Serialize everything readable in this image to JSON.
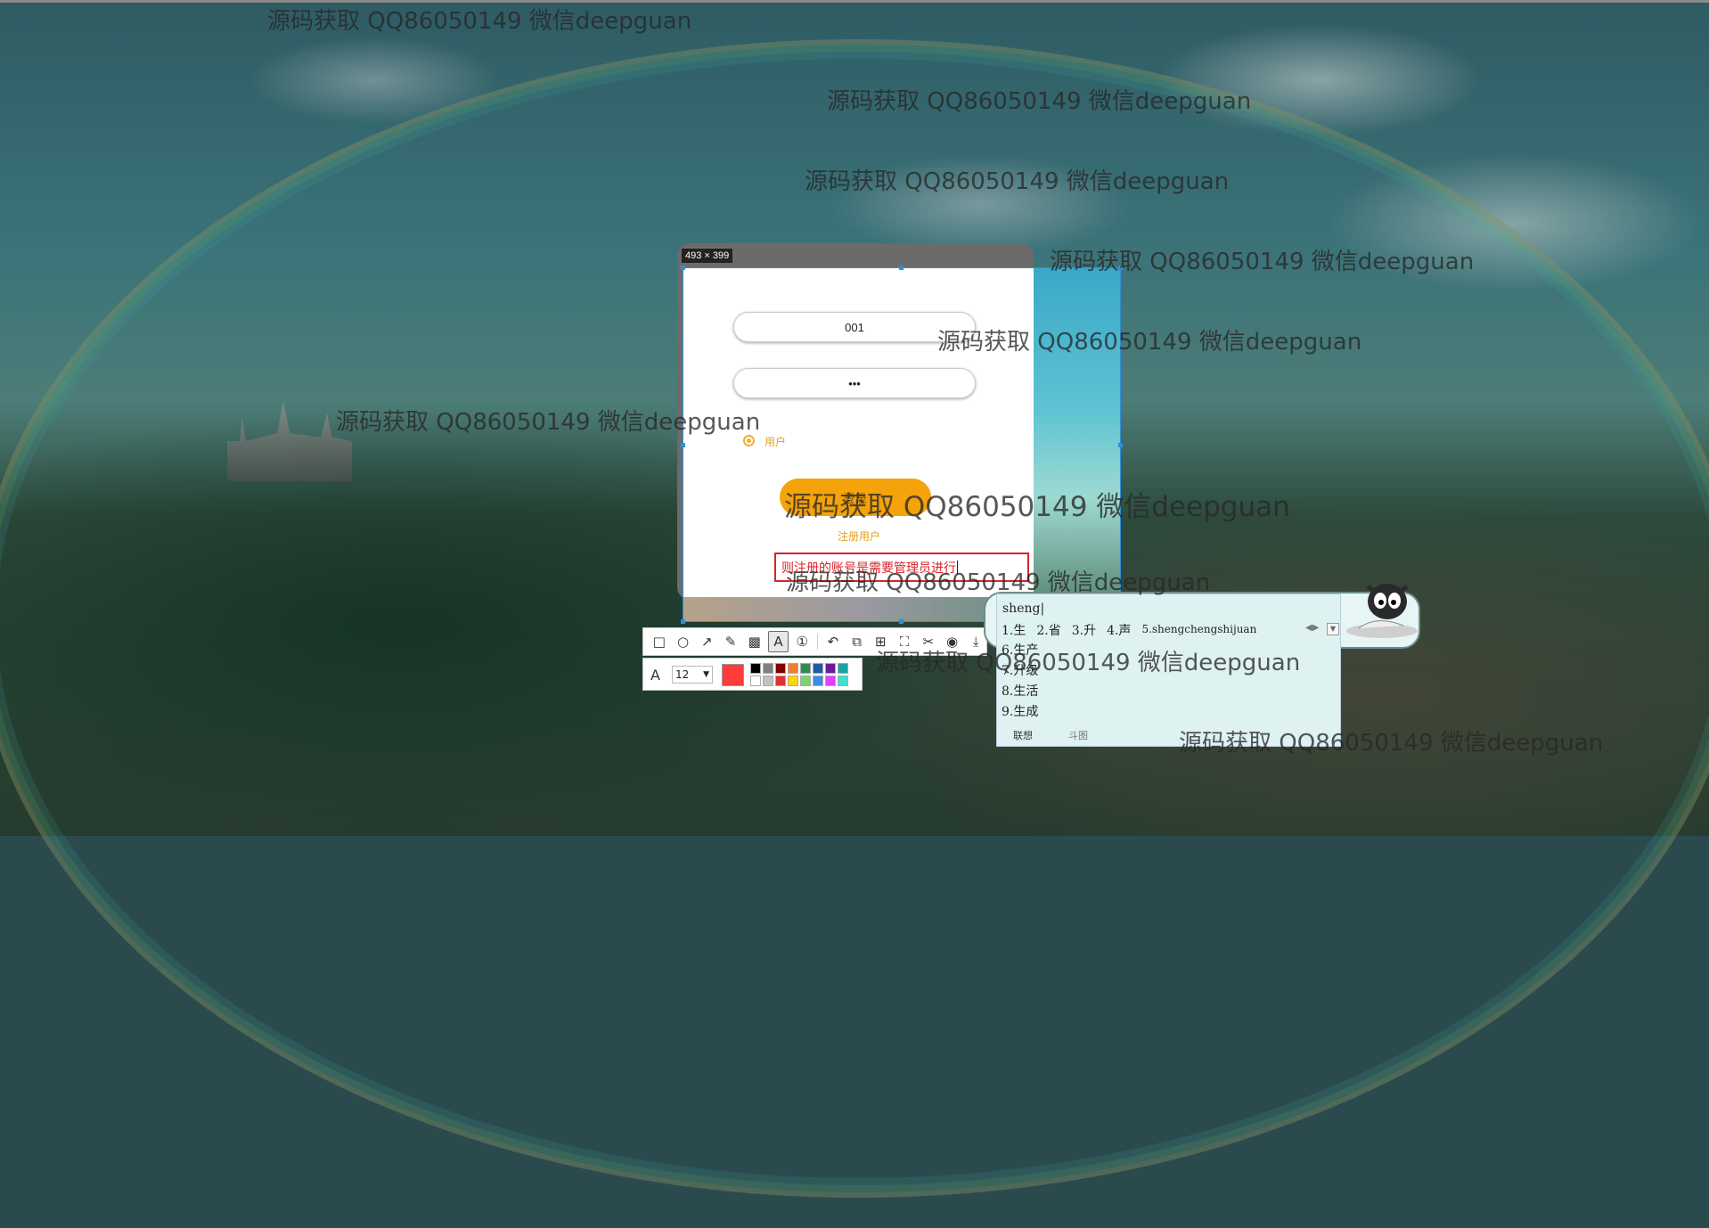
{
  "watermark_text": "源码获取 QQ86050149 微信deepguan",
  "capture": {
    "size_label": "493 × 399"
  },
  "login_form": {
    "username_value": "001",
    "password_value": "•••",
    "role_radio_label": "用户",
    "login_button_label": "登录",
    "register_link": "注册用户"
  },
  "annotation": {
    "text": "则注册的账号是需要管理员进行"
  },
  "toolbar": {
    "tools": [
      {
        "name": "rectangle-tool-icon",
        "glyph": "□"
      },
      {
        "name": "ellipse-tool-icon",
        "glyph": "○"
      },
      {
        "name": "arrow-tool-icon",
        "glyph": "↗"
      },
      {
        "name": "pen-tool-icon",
        "glyph": "✎"
      },
      {
        "name": "mosaic-tool-icon",
        "glyph": "▩"
      },
      {
        "name": "text-tool-icon",
        "glyph": "A"
      },
      {
        "name": "number-tool-icon",
        "glyph": "①"
      },
      {
        "name": "undo-icon",
        "glyph": "↶"
      },
      {
        "name": "translate-icon",
        "glyph": "⧉"
      },
      {
        "name": "ocr-icon",
        "glyph": "⊞"
      },
      {
        "name": "long-screenshot-icon",
        "glyph": "⛶"
      },
      {
        "name": "pin-icon",
        "glyph": "✂"
      },
      {
        "name": "record-icon",
        "glyph": "◉"
      },
      {
        "name": "save-icon",
        "glyph": "⤓"
      }
    ],
    "font_size": "12",
    "current_color": "#ff3b3b",
    "palette": [
      "#000000",
      "#808080",
      "#800000",
      "#f08030",
      "#2e8b57",
      "#1e5aa8",
      "#6a1b9a",
      "#1aa3a3",
      "#ffffff",
      "#c0c0c0",
      "#e03030",
      "#ffd700",
      "#7cd070",
      "#3a8ee6",
      "#e040fb",
      "#40e0d0"
    ]
  },
  "ime": {
    "pinyin": "sheng",
    "candidates": [
      {
        "text": "1.生"
      },
      {
        "text": "2.省"
      },
      {
        "text": "3.升"
      },
      {
        "text": "4.声"
      },
      {
        "text": "5.shengchengshijuan"
      }
    ],
    "more_candidates": [
      "6.生产",
      "7.升级",
      "8.生活",
      "9.生成"
    ],
    "tabs": [
      "联想",
      "斗图"
    ]
  }
}
